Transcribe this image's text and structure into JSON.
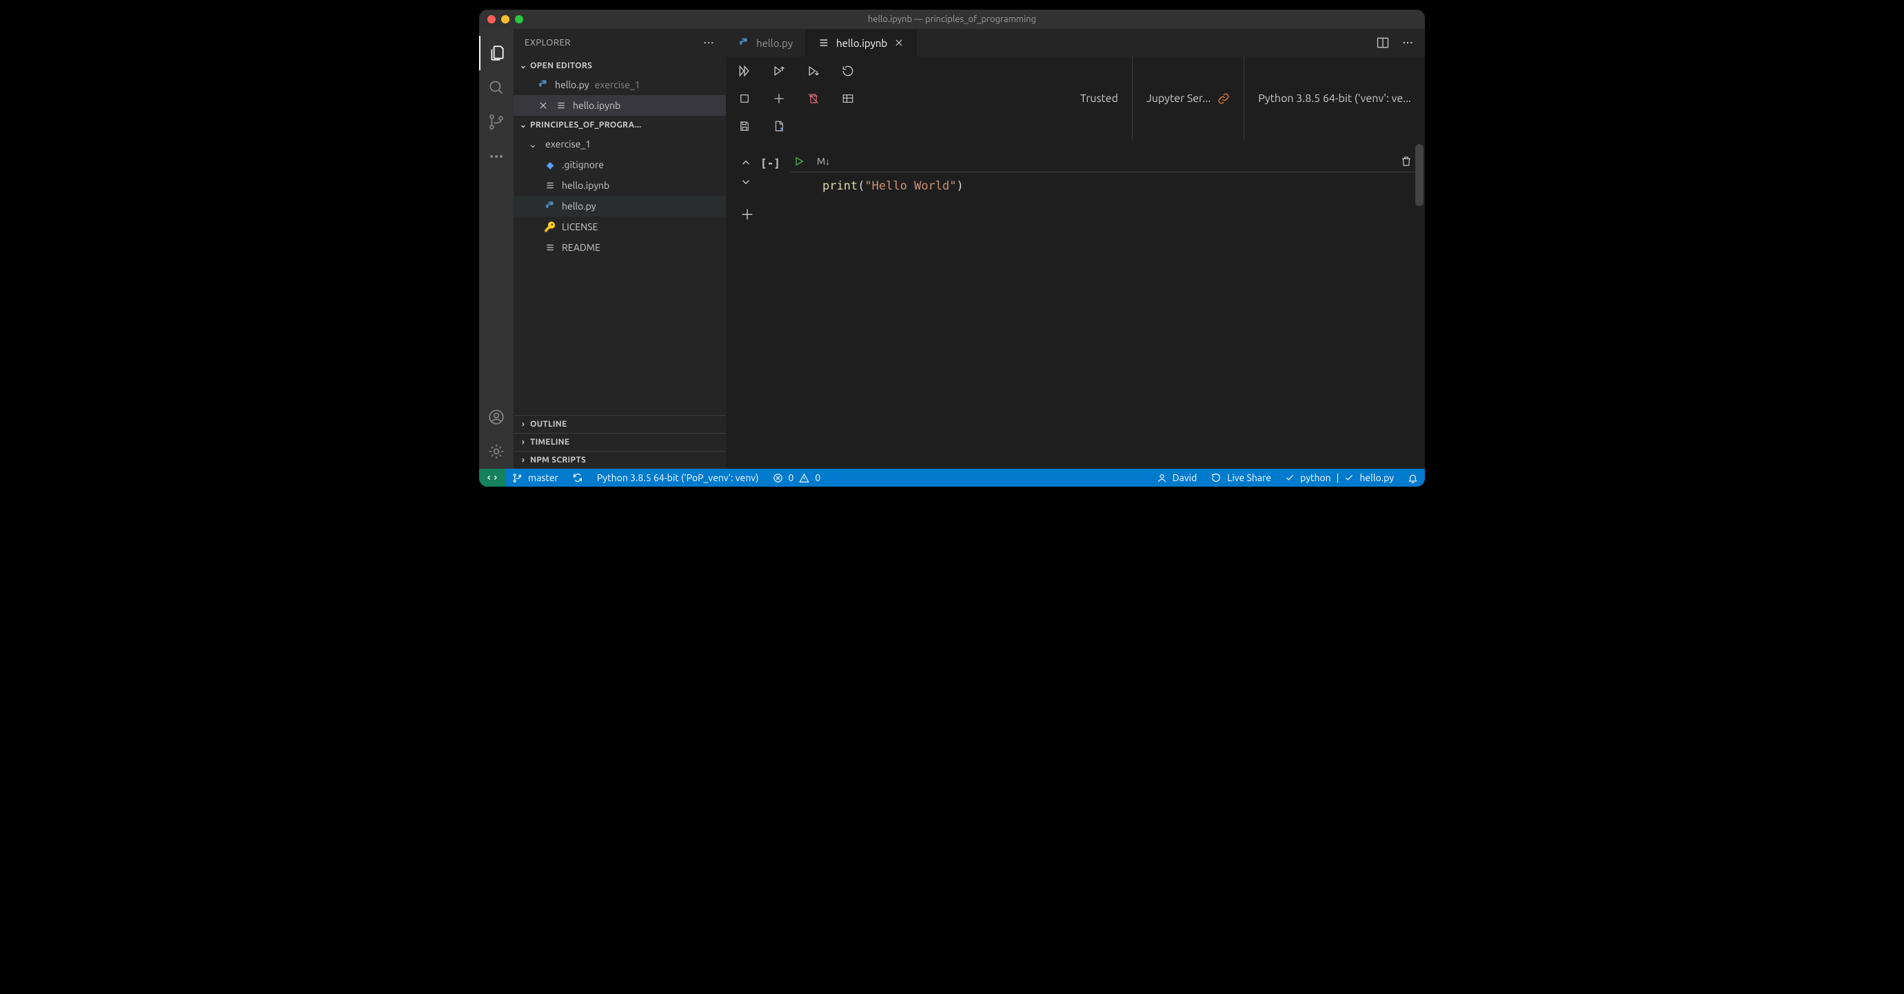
{
  "window": {
    "title": "hello.ipynb — principles_of_programming"
  },
  "sidebar": {
    "title": "EXPLORER",
    "open_editors_label": "OPEN EDITORS",
    "open_editors": [
      {
        "name": "hello.py",
        "hint": "exercise_1",
        "icon": "python"
      },
      {
        "name": "hello.ipynb",
        "hint": "",
        "icon": "notebook"
      }
    ],
    "workspace_label": "PRINCIPLES_OF_PROGRA...",
    "folder": "exercise_1",
    "files": [
      {
        "name": ".gitignore",
        "icon": "git"
      },
      {
        "name": "hello.ipynb",
        "icon": "notebook"
      },
      {
        "name": "hello.py",
        "icon": "python"
      },
      {
        "name": "LICENSE",
        "icon": "key"
      },
      {
        "name": "README",
        "icon": "notebook"
      }
    ],
    "panels": {
      "outline": "OUTLINE",
      "timeline": "TIMELINE",
      "npm": "NPM SCRIPTS"
    }
  },
  "tabs": [
    {
      "name": "hello.py",
      "icon": "python",
      "active": false
    },
    {
      "name": "hello.ipynb",
      "icon": "notebook",
      "active": true
    }
  ],
  "notebook": {
    "trusted": "Trusted",
    "server": "Jupyter Ser...",
    "kernel": "Python 3.8.5 64-bit ('venv': ve...",
    "cell": {
      "collapse": "[-]",
      "markdown_btn": "M↓",
      "code_fn": "print",
      "code_open": "(",
      "code_str": "\"Hello World\"",
      "code_close": ")"
    }
  },
  "status": {
    "branch": "master",
    "python": "Python 3.8.5 64-bit ('PoP_venv': venv)",
    "errors": "0",
    "warnings": "0",
    "user": "David",
    "liveshare": "Live Share",
    "lang": "python",
    "linter": "hello.py"
  }
}
